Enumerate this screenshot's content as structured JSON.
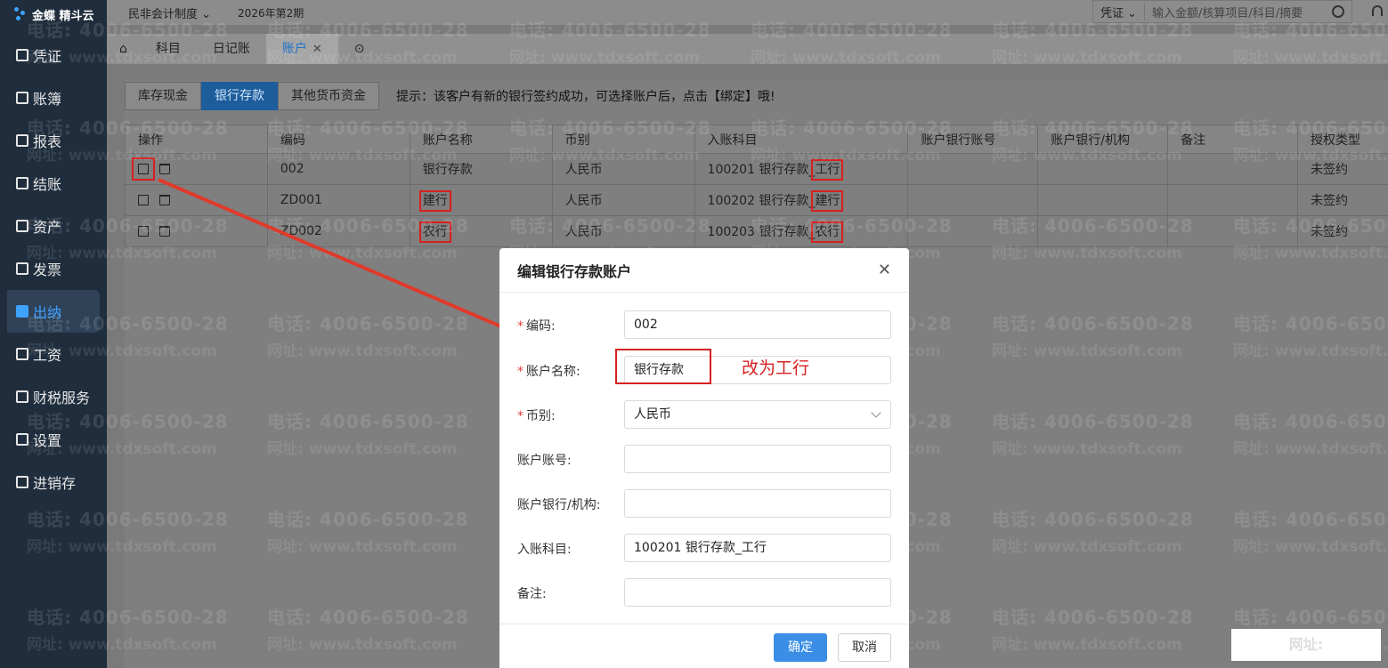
{
  "app": {
    "logo_text": "金蝶 精斗云"
  },
  "sidebar": {
    "items": [
      {
        "label": "凭证",
        "icon": "voucher-icon"
      },
      {
        "label": "账簿",
        "icon": "ledger-icon"
      },
      {
        "label": "报表",
        "icon": "report-icon"
      },
      {
        "label": "结账",
        "icon": "closing-icon"
      },
      {
        "label": "资产",
        "icon": "asset-icon"
      },
      {
        "label": "发票",
        "icon": "invoice-icon"
      },
      {
        "label": "出纳",
        "icon": "cashier-icon",
        "active": true
      },
      {
        "label": "工资",
        "icon": "salary-icon"
      },
      {
        "label": "财税服务",
        "icon": "tax-service-icon"
      },
      {
        "label": "设置",
        "icon": "settings-icon"
      },
      {
        "label": "进销存",
        "icon": "inventory-icon"
      }
    ]
  },
  "topbar": {
    "system": "民非会计制度",
    "period": "2026年第2期",
    "search_type": "凭证",
    "search_placeholder": "输入金额/核算项目/科目/摘要"
  },
  "tabs": [
    {
      "label": "科目"
    },
    {
      "label": "日记账"
    },
    {
      "label": "账户",
      "active": true,
      "closable": true
    }
  ],
  "account_types": [
    "库存现金",
    "银行存款",
    "其他货币资金"
  ],
  "tip": "提示：该客户有新的银行签约成功，可选择账户后，点击【绑定】哦!",
  "table": {
    "headers": [
      "操作",
      "编码",
      "账户名称",
      "币别",
      "入账科目",
      "账户银行账号",
      "账户银行/机构",
      "备注",
      "授权类型"
    ],
    "rows": [
      {
        "code": "002",
        "name": "银行存款",
        "currency": "人民币",
        "subject_prefix": "100201 银行存款_",
        "subject_bank": "工行",
        "account_no": "",
        "institution": "",
        "remark": "",
        "auth": "未签约"
      },
      {
        "code": "ZD001",
        "name": "建行",
        "currency": "人民币",
        "subject_prefix": "100202 银行存款_",
        "subject_bank": "建行",
        "account_no": "",
        "institution": "",
        "remark": "",
        "auth": "未签约"
      },
      {
        "code": "ZD002",
        "name": "农行",
        "currency": "人民币",
        "subject_prefix": "100203 银行存款_",
        "subject_bank": "农行",
        "account_no": "",
        "institution": "",
        "remark": "",
        "auth": "未签约"
      }
    ]
  },
  "dialog": {
    "title": "编辑银行存款账户",
    "fields": {
      "code_label": "编码:",
      "code_value": "002",
      "name_label": "账户名称:",
      "name_value": "银行存款",
      "currency_label": "币别:",
      "currency_value": "人民币",
      "account_no_label": "账户账号:",
      "account_no_value": "",
      "institution_label": "账户银行/机构:",
      "institution_value": "",
      "subject_label": "入账科目:",
      "subject_value": "100201 银行存款_工行",
      "remark_label": "备注:",
      "remark_value": ""
    },
    "annotation": "改为工行",
    "ok_label": "确定",
    "cancel_label": "取消"
  },
  "watermark": {
    "phone": "电话: 4006-6500-28",
    "site": "网址: www.tdxsoft.com"
  }
}
